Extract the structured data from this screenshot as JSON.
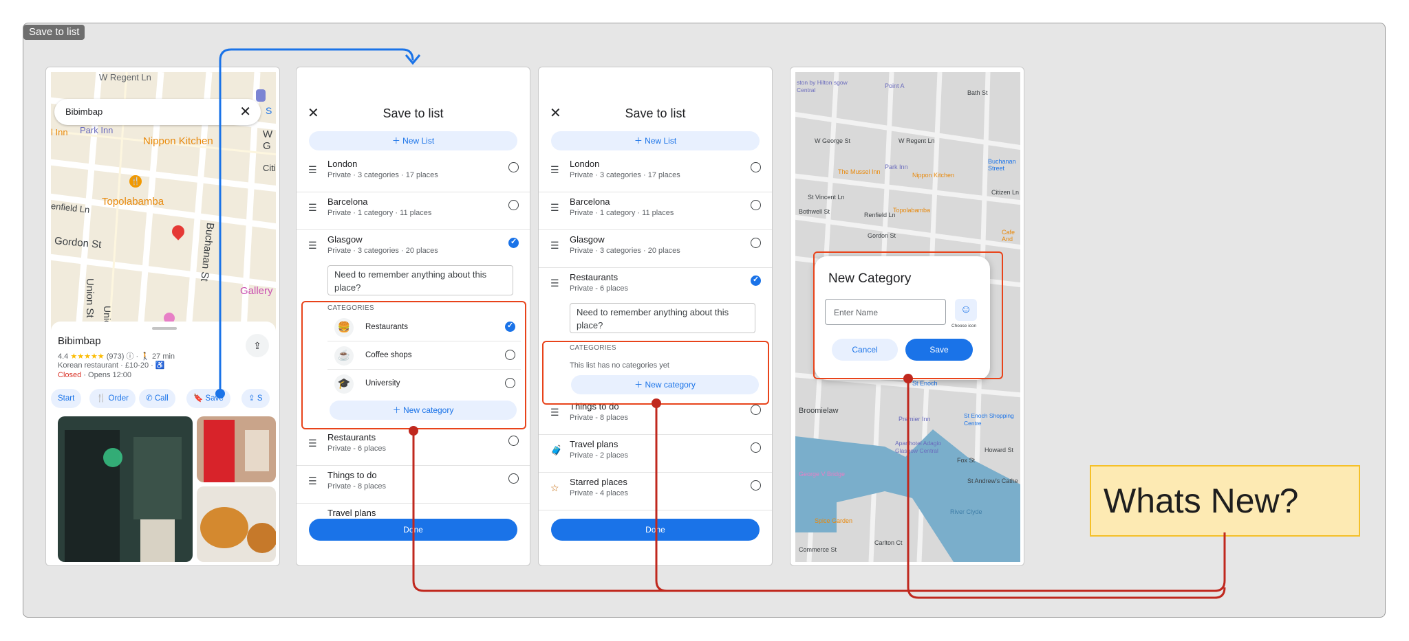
{
  "frame": {
    "label": "Save to list"
  },
  "screen1": {
    "search_value": "Bibimbap",
    "map_labels": [
      "W Regent Ln",
      "Park Inn",
      "Nippon Kitchen",
      "Topolabamba",
      "enfield Ln",
      "Gordon St",
      "Union Pl",
      "Union St",
      "Buchanan St",
      "Gallery",
      "W G",
      "Citi",
      "l Inn",
      "S"
    ],
    "place": {
      "name": "Bibimbap",
      "rating": "4.4",
      "stars": "★★★★★",
      "reviews": "(973)",
      "walk": "27 min",
      "type_price": "Korean restaurant · £10-20 ·",
      "status": "Closed",
      "opens": "· Opens 12:00"
    },
    "actions": [
      "Start",
      "Order",
      "Call",
      "Save",
      "S"
    ]
  },
  "screen2": {
    "title": "Save to list",
    "new_list": "New List",
    "lists": [
      {
        "title": "London",
        "sub": "Private · 3 categories · 17 places"
      },
      {
        "title": "Barcelona",
        "sub": "Private · 1 category · 11 places"
      },
      {
        "title": "Glasgow",
        "sub": "Private · 3 categories · 20 places"
      }
    ],
    "note": "Need to remember anything about this place?",
    "categories_label": "CATEGORIES",
    "categories": [
      {
        "label": "Restaurants",
        "icon": "🍔"
      },
      {
        "label": "Coffee shops",
        "icon": "☕"
      },
      {
        "label": "University",
        "icon": "🎓"
      }
    ],
    "new_category": "New category",
    "more_lists": [
      {
        "title": "Restaurants",
        "sub": "Private - 6 places"
      },
      {
        "title": "Things to do",
        "sub": "Private - 8 places"
      },
      {
        "title": "Travel plans",
        "sub": ""
      }
    ],
    "done": "Done"
  },
  "screen3": {
    "title": "Save to list",
    "new_list": "New List",
    "lists": [
      {
        "title": "London",
        "sub": "Private · 3 categories · 17 places"
      },
      {
        "title": "Barcelona",
        "sub": "Private · 1 category · 11 places"
      },
      {
        "title": "Glasgow",
        "sub": "Private · 3 categories · 20 places"
      },
      {
        "title": "Restaurants",
        "sub": "Private - 6 places"
      }
    ],
    "note": "Need to remember anything about this place?",
    "categories_label": "CATEGORIES",
    "no_categories": "This list has no categories yet",
    "new_category": "New category",
    "more_lists": [
      {
        "title": "Things to do",
        "sub": "Private - 8 places"
      },
      {
        "title": "Travel plans",
        "sub": "Private - 2 places"
      },
      {
        "title": "Starred places",
        "sub": "Private - 4 places"
      }
    ],
    "done": "Done"
  },
  "screen4": {
    "map_labels": [
      "Bath St",
      "W George St",
      "W Regent Ln",
      "Park Inn",
      "Nippon Kitchen",
      "The Mussel Inn",
      "Buchanan Street",
      "Topolabamba",
      "Gordon St",
      "St Vincent Ln",
      "Renfield Ln",
      "Bothwell St",
      "St Enoch",
      "Premier Inn",
      "Broomielaw",
      "St Enoch Shopping Centre",
      "Aparthotel Adagio Glasgow Central",
      "Howard St",
      "Fox St",
      "St Andrew's Cathe",
      "George V Bridge",
      "Spice Garden",
      "Carlton Ct",
      "Commerce St",
      "River Clyde",
      "Point A",
      "Cafe And",
      "ston by Hilton sgow Central",
      "Citizen Ln"
    ],
    "dialog": {
      "title": "New Category",
      "placeholder": "Enter Name",
      "icon_label": "Choose icon",
      "cancel": "Cancel",
      "save": "Save"
    }
  },
  "callout": {
    "text": "Whats New?"
  },
  "colors": {
    "accent": "#1a73e8",
    "highlight": "#e8431a",
    "connector": "#c0281e",
    "flow": "#1a73e8",
    "callout_bg": "#fdeab3"
  }
}
